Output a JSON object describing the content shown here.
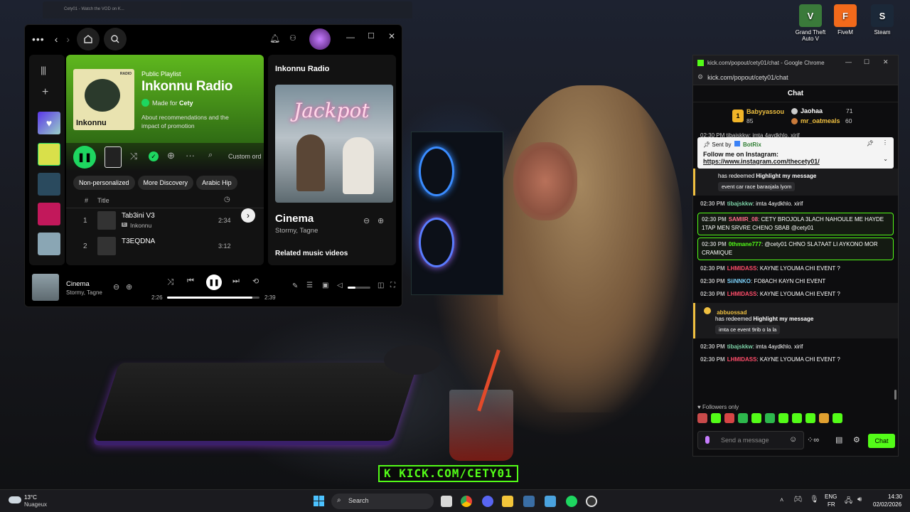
{
  "desktop": {
    "icons": [
      {
        "label": "Grand Theft\nAuto V",
        "icon": "gta-icon",
        "color": "#3a7a3a",
        "glyph": "V"
      },
      {
        "label": "FiveM",
        "icon": "fivem-icon",
        "color": "#f26a1b",
        "glyph": "F"
      },
      {
        "label": "Steam",
        "icon": "steam-icon",
        "color": "#1b2838",
        "glyph": "S"
      }
    ],
    "monitor_tab": "Cety01 - Watch the VOD on K..."
  },
  "spotify": {
    "playlist_type": "Public Playlist",
    "playlist_name": "Inkonnu Radio",
    "cover_text": "Inkonnu",
    "cover_badge": "RADIO",
    "made_for_prefix": "Made for",
    "made_for_user": "Cety",
    "description": "About recommendations and the impact of promotion",
    "sort_label": "Custom ord",
    "chips": [
      "Non-personalized",
      "More Discovery",
      "Arabic Hip"
    ],
    "col_num": "#",
    "col_title": "Title",
    "tracks": [
      {
        "num": "1",
        "title": "Tab3ini V3",
        "artist": "Inkonnu",
        "explicit": "E",
        "duration": "2:34"
      },
      {
        "num": "2",
        "title": "T3EQDNA",
        "artist": "",
        "explicit": "",
        "duration": "3:12"
      }
    ],
    "right_panel": {
      "title": "Inkonnu Radio",
      "art_text": "Jackpot",
      "song": "Cinema",
      "artists": "Stormy, Tagne",
      "related": "Related music videos"
    },
    "now_playing": {
      "title": "Cinema",
      "artists": "Stormy, Tagne",
      "elapsed": "2:26",
      "total": "2:39",
      "progress": 0.92,
      "volume": 0.35
    },
    "accent": "#1ed760"
  },
  "chat": {
    "window_title": "kick.com/popout/cety01/chat - Google Chrome",
    "url": "kick.com/popout/cety01/chat",
    "header": "Chat",
    "leaderboard": {
      "first": {
        "rank": "1",
        "name": "Babyyassou",
        "points": "85"
      },
      "second": {
        "name": "Jaohaa",
        "points": "71"
      },
      "third": {
        "name": "mr_oatmeals",
        "points": "60"
      }
    },
    "partial_line": "02:30 PM tibajskkw: imta 4aydkhlo. xirif",
    "pinned": {
      "sent_by": "Sent by",
      "bot": "BotRix",
      "text": "Follow me on Instagram:",
      "link": "https://www.instagram.com/thecety01/"
    },
    "redeem1": {
      "action": "has redeemed",
      "item": "Highlight my message",
      "message": "event car race baraojala lyom"
    },
    "messages": [
      {
        "time": "02:30 PM",
        "user": "tibajskkw",
        "color": "#7dd3a8",
        "text": "imta 4aydkhlo. xirif",
        "highlight": false
      },
      {
        "time": "02:30 PM",
        "user": "SAMIIR_08",
        "color": "#ff6b8a",
        "text": "CETY BROJOLA 3LACH NAHOULE ME HAYDE 1TAP MEN SRVRE CHENO SBAB @cety01",
        "highlight": true
      },
      {
        "time": "02:30 PM",
        "user": "0thmane777",
        "color": "#53fc18",
        "text": "@cety01 CHNO SLA7AAT LI AYKONO MOR CRAMIQUE",
        "highlight": true
      },
      {
        "time": "02:30 PM",
        "user": "LHMIDASS",
        "color": "#ff4d6a",
        "text": "KAYNE LYOUMA CHI EVENT ?",
        "highlight": false
      },
      {
        "time": "02:30 PM",
        "user": "SiiNNKO",
        "color": "#7dd3fc",
        "text": "FO8ACH KAYN CHI EVENT",
        "highlight": false
      },
      {
        "time": "02:30 PM",
        "user": "LHMIDASS",
        "color": "#ff4d6a",
        "text": "KAYNE LYOUMA CHI EVENT ?",
        "highlight": false
      }
    ],
    "redeem2": {
      "user": "abbuossad",
      "action": "has redeemed",
      "item": "Highlight my message",
      "message": "imta ce event 9rib o la la"
    },
    "messages2": [
      {
        "time": "02:30 PM",
        "user": "tibajskkw",
        "color": "#7dd3a8",
        "text": "imta 4aydkhlo. xirif"
      },
      {
        "time": "02:30 PM",
        "user": "LHMIDASS",
        "color": "#ff4d6a",
        "text": "KAYNE LYOUMA CHI EVENT ?"
      }
    ],
    "followers_only": "Followers only",
    "input_placeholder": "Send a message",
    "send_label": "Chat",
    "accent": "#53fc18"
  },
  "overlay": {
    "banner": "K KICK.COM/CETY01"
  },
  "taskbar": {
    "weather_temp": "13°C",
    "weather_desc": "Nuageux",
    "search_placeholder": "Search",
    "lang": "ENG",
    "lang_sub": "FR",
    "time": "14:30",
    "date": "02/02/2026"
  }
}
